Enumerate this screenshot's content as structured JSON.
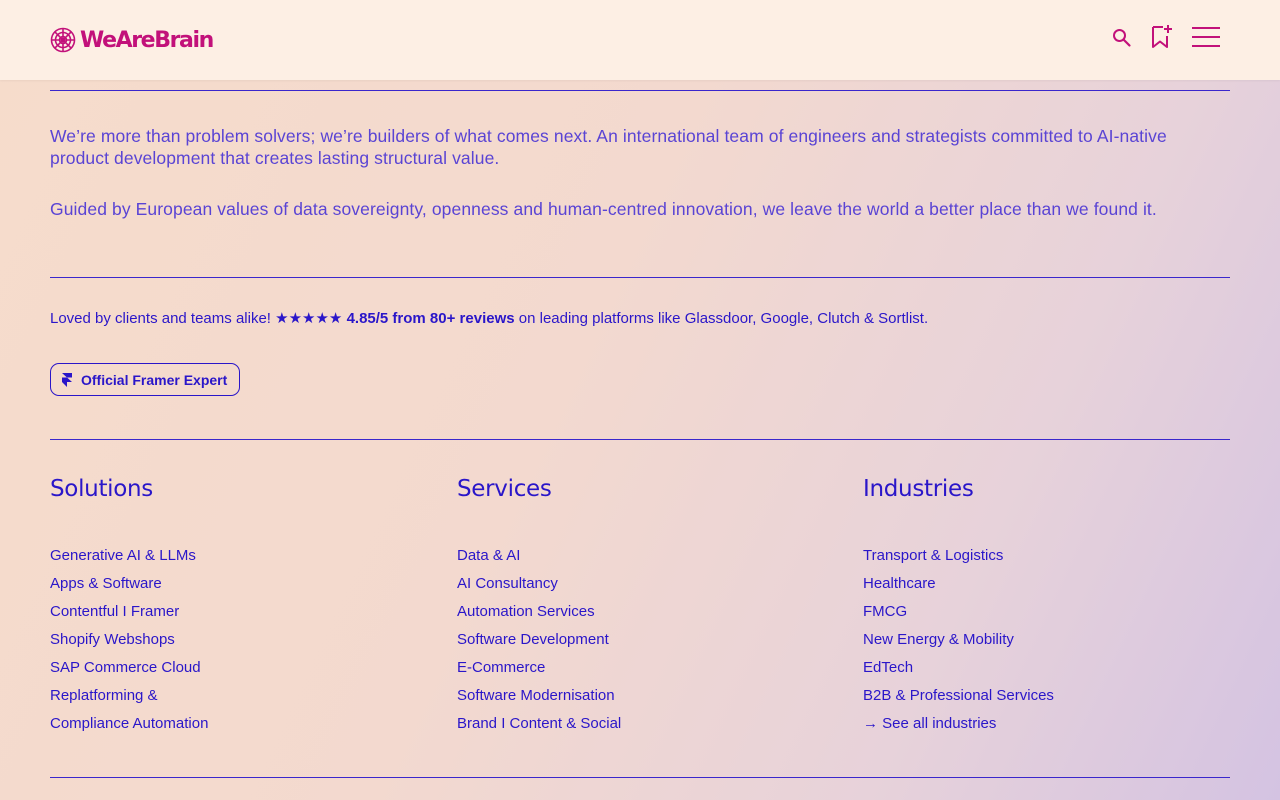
{
  "header": {
    "logo_text": "WeAreBrain",
    "icons": [
      "search-icon",
      "bookmark-icon",
      "menu-icon"
    ]
  },
  "intro": {
    "paragraph_1": "We’re more than problem solvers; we’re builders of what comes next. An international team of engineers and strategists committed to AI-native product development that creates lasting structural value.",
    "paragraph_2": "Guided by European values of data sovereignty, openness and human-centred innovation, we leave the world a better place than we found it."
  },
  "reviews": {
    "prefix": "Loved by clients and teams alike!",
    "stars": "★★★★★",
    "rating": "4.85/5 from 80+ reviews",
    "suffix": "on leading platforms like Glassdoor, Google, Clutch & Sortlist."
  },
  "badge": {
    "label": "Official Framer Expert",
    "icon": "framer-icon"
  },
  "footer": {
    "columns": [
      {
        "title": "Solutions",
        "items": [
          "Generative AI & LLMs",
          "Apps & Software",
          "Contentful I Framer",
          "Shopify Webshops",
          "SAP Commerce Cloud",
          "Replatforming &",
          "Compliance Automation"
        ]
      },
      {
        "title": "Services",
        "items": [
          "Data & AI",
          "AI Consultancy",
          "Automation Services",
          "Software Development",
          "E-Commerce",
          "Software Modernisation",
          "Brand I Content & Social"
        ]
      },
      {
        "title": "Industries",
        "items": [
          "Transport & Logistics",
          "Healthcare",
          "FMCG",
          "New Energy & Mobility",
          "EdTech",
          "B2B & Professional Services",
          "→ See all industries"
        ]
      }
    ]
  },
  "colors": {
    "brand": "#c2117a",
    "accent": "#2a16c9",
    "intro_text": "#5a44d4",
    "header_bg": "#fdefe4"
  }
}
